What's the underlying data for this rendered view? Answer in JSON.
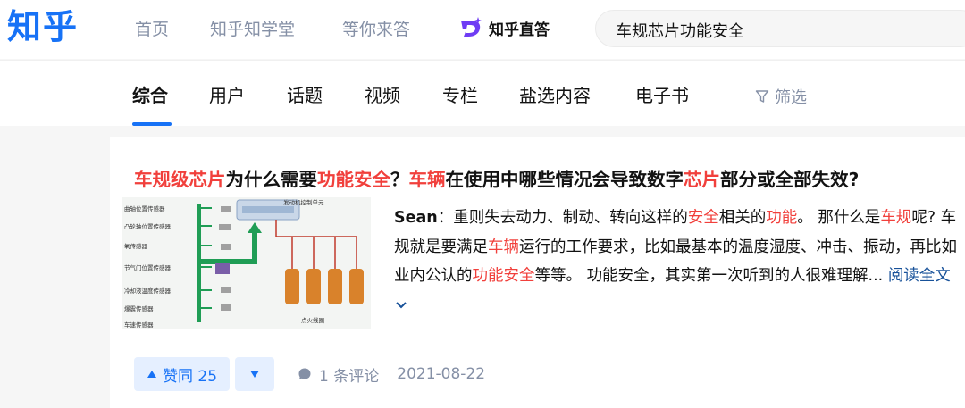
{
  "logo": "知乎",
  "nav": {
    "home": "首页",
    "xuetang": "知乎知学堂",
    "waiting": "等你来答",
    "zhida": "知乎直答"
  },
  "search": {
    "value": "车规芯片功能安全"
  },
  "tabs": [
    "综合",
    "用户",
    "话题",
    "视频",
    "专栏",
    "盐选内容",
    "电子书"
  ],
  "filter_label": "筛选",
  "result": {
    "title_parts": [
      {
        "text": "车规级芯片",
        "hl": true
      },
      {
        "text": "为什么需要",
        "hl": false
      },
      {
        "text": "功能安全",
        "hl": true
      },
      {
        "text": "？",
        "hl": false
      },
      {
        "text": "车辆",
        "hl": true
      },
      {
        "text": "在使用中哪些情况会导致数字",
        "hl": false
      },
      {
        "text": "芯片",
        "hl": true
      },
      {
        "text": "部分或全部失效?",
        "hl": false
      }
    ],
    "thumb_labels": [
      "曲轴位置传感器",
      "凸轮轴位置传感器",
      "氧传感器",
      "节气门位置传感器",
      "冷却液温度传感器",
      "爆震传感器",
      "车速传感器",
      "发动机控制单元",
      "点火线圈"
    ],
    "author": "Sean",
    "excerpt_parts": [
      {
        "text": "：重则失去动力、制动、转向这样的",
        "hl": false
      },
      {
        "text": "安全",
        "hl": true
      },
      {
        "text": "相关的",
        "hl": false
      },
      {
        "text": "功能",
        "hl": true
      },
      {
        "text": "。 那什么是",
        "hl": false
      },
      {
        "text": "车规",
        "hl": true
      },
      {
        "text": "呢? 车规就是要满足",
        "hl": false
      },
      {
        "text": "车辆",
        "hl": true
      },
      {
        "text": "运行的工作要求，比如最基本的温度湿度、冲击、振动，再比如业内公认的",
        "hl": false
      },
      {
        "text": "功能安全",
        "hl": true
      },
      {
        "text": "等等。 功能安全，其实第一次听到的人很难理解... ",
        "hl": false
      }
    ],
    "read_more": "阅读全文",
    "upvote_label": "赞同 25",
    "comments": "1 条评论",
    "date": "2021-08-22"
  },
  "colors": {
    "brand": "#1772f6",
    "highlight": "#f1403c",
    "muted": "#8590a6"
  }
}
